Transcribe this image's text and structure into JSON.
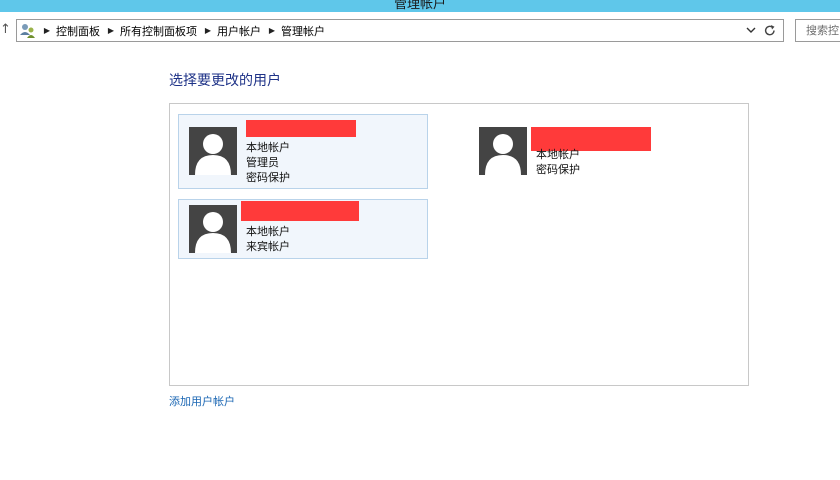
{
  "window": {
    "title": "管理帐户"
  },
  "address": {
    "breadcrumbs": [
      "控制面板",
      "所有控制面板项",
      "用户帐户",
      "管理帐户"
    ]
  },
  "search": {
    "placeholder": "搜索控"
  },
  "main": {
    "heading": "选择要更改的用户",
    "accounts": [
      {
        "name": "",
        "lines": [
          "本地帐户",
          "管理员",
          "密码保护"
        ]
      },
      {
        "name": "",
        "lines": [
          "本地帐户",
          "密码保护"
        ]
      },
      {
        "name": "",
        "lines": [
          "本地帐户",
          "来宾帐户"
        ]
      }
    ],
    "add_account_link": "添加用户帐户"
  },
  "icons": {
    "up": "arrow-up-icon",
    "address": "user-accounts-icon",
    "separator": "chevron-right-icon",
    "dropdown": "chevron-down-icon",
    "refresh": "refresh-icon",
    "avatar": "user-silhouette-icon"
  },
  "colors": {
    "titlebar": "#5fc7ea",
    "heading": "#1e3287",
    "link": "#1a66b3",
    "tile_selected_bg": "#f1f6fc",
    "tile_selected_border": "#b9d3ea",
    "redaction": "#ff3a3a"
  }
}
